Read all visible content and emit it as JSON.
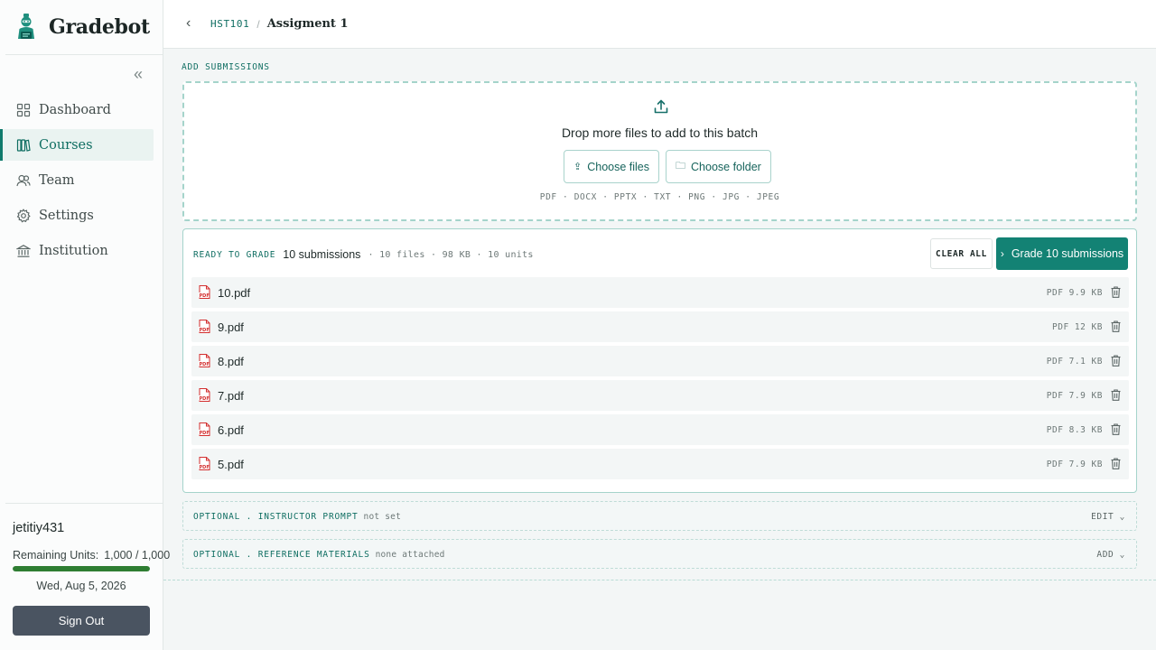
{
  "app": {
    "name": "Gradebot",
    "logo_icon": "robot-teacher-logo",
    "accent_color": "#138274"
  },
  "sidebar": {
    "collapse_icon": "double-chevron-left-icon",
    "items": [
      {
        "label": "Dashboard",
        "icon": "grid-icon",
        "active": false
      },
      {
        "label": "Courses",
        "icon": "books-icon",
        "active": true
      },
      {
        "label": "Team",
        "icon": "users-icon",
        "active": false
      },
      {
        "label": "Settings",
        "icon": "gear-icon",
        "active": false
      },
      {
        "label": "Institution",
        "icon": "bank-icon",
        "active": false
      }
    ],
    "user": {
      "username": "jetitiy431",
      "units_label": "Remaining Units:",
      "units_value": "1,000 / 1,000",
      "units_fraction": 1.0,
      "date": "Wed, Aug 5, 2026",
      "signout_label": "Sign Out"
    }
  },
  "header": {
    "course_code": "HST101",
    "separator": "/",
    "page_title": "Assigment 1"
  },
  "upload": {
    "section_label": "ADD SUBMISSIONS",
    "drop_text": "Drop more files to add to this batch",
    "choose_files_label": "Choose files",
    "choose_folder_label": "Choose folder",
    "formats": "PDF · DOCX · PPTX · TXT · PNG · JPG · JPEG"
  },
  "ready": {
    "label": "READY TO GRADE",
    "count": "10 submissions",
    "meta": "· 10 files · 98 KB · 10 units",
    "clear_label": "CLEAR ALL",
    "grade_label": "Grade 10 submissions",
    "files": [
      {
        "name": "10.pdf",
        "meta": "PDF  9.9 KB"
      },
      {
        "name": "9.pdf",
        "meta": "PDF  12 KB"
      },
      {
        "name": "8.pdf",
        "meta": "PDF  7.1 KB"
      },
      {
        "name": "7.pdf",
        "meta": "PDF  7.9 KB"
      },
      {
        "name": "6.pdf",
        "meta": "PDF  8.3 KB"
      },
      {
        "name": "5.pdf",
        "meta": "PDF  7.9 KB"
      }
    ]
  },
  "optional": {
    "prompt": {
      "title": "OPTIONAL . INSTRUCTOR PROMPT",
      "note": "not set",
      "action": "EDIT"
    },
    "materials": {
      "title": "OPTIONAL . REFERENCE MATERIALS",
      "note": "none attached",
      "action": "ADD"
    }
  }
}
